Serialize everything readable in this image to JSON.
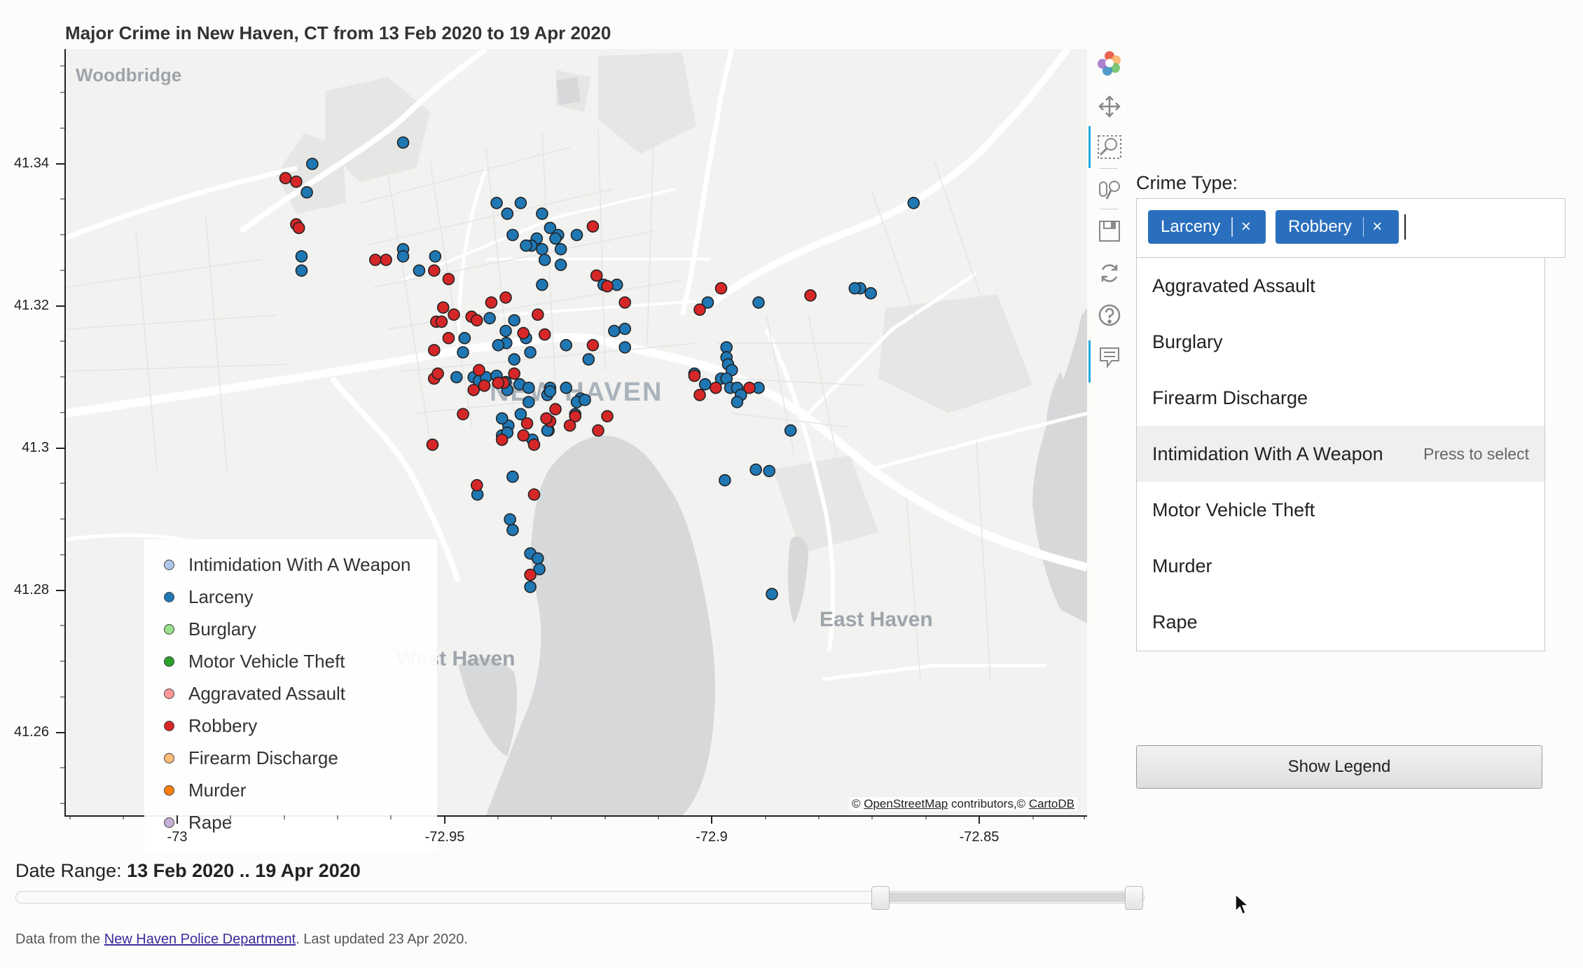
{
  "title": "Major Crime in New Haven, CT from 13 Feb 2020 to 19 Apr 2020",
  "map": {
    "place_labels": [
      "Woodbridge",
      "NEW HAVEN",
      "West Haven",
      "East Haven"
    ],
    "attribution": {
      "prefix": "©",
      "osm_link": "OpenStreetMap",
      "middle": "contributors,©",
      "carto_link": "CartoDB"
    },
    "y_ticks": [
      "41.34",
      "41.32",
      "41.3",
      "41.28",
      "41.26"
    ],
    "x_ticks": [
      "-73",
      "-72.95",
      "-72.9",
      "-72.85"
    ],
    "colors": {
      "larceny": "#1f77b4",
      "robbery": "#d62728",
      "water": "#d4d6d8",
      "land": "#f3f3f1"
    },
    "points": {
      "larceny": [
        [
          -72.958,
          41.343
        ],
        [
          -72.975,
          41.34
        ],
        [
          -72.976,
          41.336
        ],
        [
          -72.977,
          41.327
        ],
        [
          -72.977,
          41.325
        ],
        [
          -72.958,
          41.328
        ],
        [
          -72.958,
          41.327
        ],
        [
          -72.955,
          41.325
        ],
        [
          -72.952,
          41.327
        ],
        [
          -72.9405,
          41.3345
        ],
        [
          -72.936,
          41.3345
        ],
        [
          -72.9385,
          41.333
        ],
        [
          -72.932,
          41.333
        ],
        [
          -72.9305,
          41.331
        ],
        [
          -72.929,
          41.33
        ],
        [
          -72.9255,
          41.33
        ],
        [
          -72.9375,
          41.33
        ],
        [
          -72.933,
          41.3295
        ],
        [
          -72.934,
          41.3285
        ],
        [
          -72.935,
          41.3285
        ],
        [
          -72.932,
          41.328
        ],
        [
          -72.9295,
          41.3295
        ],
        [
          -72.9285,
          41.328
        ],
        [
          -72.9315,
          41.3265
        ],
        [
          -72.9285,
          41.3258
        ],
        [
          -72.932,
          41.323
        ],
        [
          -72.9205,
          41.323
        ],
        [
          -72.918,
          41.323
        ],
        [
          -72.9185,
          41.3165
        ],
        [
          -72.9165,
          41.3168
        ],
        [
          -72.9165,
          41.3142
        ],
        [
          -72.9233,
          41.3125
        ],
        [
          -72.9372,
          41.318
        ],
        [
          -72.9388,
          41.3165
        ],
        [
          -72.9418,
          41.3183
        ],
        [
          -72.935,
          41.3155
        ],
        [
          -72.9387,
          41.3148
        ],
        [
          -72.9402,
          41.3145
        ],
        [
          -72.9372,
          41.3125
        ],
        [
          -72.9342,
          41.3135
        ],
        [
          -72.9275,
          41.3145
        ],
        [
          -72.9465,
          41.3155
        ],
        [
          -72.9468,
          41.3135
        ],
        [
          -72.948,
          41.31
        ],
        [
          -72.9448,
          41.31
        ],
        [
          -72.9438,
          41.3095
        ],
        [
          -72.9425,
          41.31
        ],
        [
          -72.9405,
          41.3102
        ],
        [
          -72.9388,
          41.3093
        ],
        [
          -72.9385,
          41.3082
        ],
        [
          -72.9362,
          41.309
        ],
        [
          -72.9345,
          41.3085
        ],
        [
          -72.9305,
          41.3085
        ],
        [
          -72.931,
          41.3075
        ],
        [
          -72.9305,
          41.308
        ],
        [
          -72.9275,
          41.3085
        ],
        [
          -72.9248,
          41.307
        ],
        [
          -72.9255,
          41.3065
        ],
        [
          -72.924,
          41.3068
        ],
        [
          -72.9258,
          41.3048
        ],
        [
          -72.9345,
          41.3065
        ],
        [
          -72.936,
          41.3048
        ],
        [
          -72.9383,
          41.3032
        ],
        [
          -72.9395,
          41.3042
        ],
        [
          -72.9395,
          41.3018
        ],
        [
          -72.9338,
          41.3012
        ],
        [
          -72.9308,
          41.3025
        ],
        [
          -72.9385,
          41.3022
        ],
        [
          -72.9375,
          41.296
        ],
        [
          -72.9441,
          41.2935
        ],
        [
          -72.938,
          41.29
        ],
        [
          -72.9375,
          41.2885
        ],
        [
          -72.9342,
          41.2852
        ],
        [
          -72.9328,
          41.2845
        ],
        [
          -72.9325,
          41.283
        ],
        [
          -72.9342,
          41.2805
        ],
        [
          -72.901,
          41.3205
        ],
        [
          -72.8975,
          41.3142
        ],
        [
          -72.8975,
          41.3128
        ],
        [
          -72.8972,
          41.3118
        ],
        [
          -72.8965,
          41.311
        ],
        [
          -72.8985,
          41.3098
        ],
        [
          -72.9015,
          41.309
        ],
        [
          -72.9035,
          41.3105
        ],
        [
          -72.8975,
          41.3098
        ],
        [
          -72.8968,
          41.3085
        ],
        [
          -72.8955,
          41.3085
        ],
        [
          -72.8948,
          41.3075
        ],
        [
          -72.8955,
          41.3065
        ],
        [
          -72.8915,
          41.3085
        ],
        [
          -72.8855,
          41.3025
        ],
        [
          -72.892,
          41.297
        ],
        [
          -72.8895,
          41.2968
        ],
        [
          -72.8978,
          41.2955
        ],
        [
          -72.889,
          41.2795
        ],
        [
          -72.8625,
          41.3345
        ],
        [
          -72.8725,
          41.3225
        ],
        [
          -72.8735,
          41.3225
        ],
        [
          -72.8705,
          41.3218
        ],
        [
          -72.8915,
          41.3205
        ],
        [
          -72.931,
          41.3025
        ]
      ],
      "robbery": [
        [
          -72.98,
          41.338
        ],
        [
          -72.978,
          41.3375
        ],
        [
          -72.978,
          41.3315
        ],
        [
          -72.9775,
          41.331
        ],
        [
          -72.9612,
          41.3265
        ],
        [
          -72.9632,
          41.3265
        ],
        [
          -72.9522,
          41.325
        ],
        [
          -72.9495,
          41.3238
        ],
        [
          -72.9505,
          41.3198
        ],
        [
          -72.9518,
          41.3178
        ],
        [
          -72.9452,
          41.3185
        ],
        [
          -72.9442,
          41.318
        ],
        [
          -72.9415,
          41.3205
        ],
        [
          -72.9388,
          41.3212
        ],
        [
          -72.9328,
          41.3188
        ],
        [
          -72.9355,
          41.3162
        ],
        [
          -72.9315,
          41.316
        ],
        [
          -72.9225,
          41.3145
        ],
        [
          -72.9218,
          41.3243
        ],
        [
          -72.9198,
          41.3228
        ],
        [
          -72.9165,
          41.3205
        ],
        [
          -72.9372,
          41.3105
        ],
        [
          -72.9392,
          41.3092
        ],
        [
          -72.9402,
          41.3092
        ],
        [
          -72.9428,
          41.3088
        ],
        [
          -72.9438,
          41.311
        ],
        [
          -72.9448,
          41.3082
        ],
        [
          -72.9522,
          41.3098
        ],
        [
          -72.9515,
          41.3105
        ],
        [
          -72.9468,
          41.3048
        ],
        [
          -72.9348,
          41.3035
        ],
        [
          -72.9305,
          41.3038
        ],
        [
          -72.9258,
          41.3045
        ],
        [
          -72.9335,
          41.3005
        ],
        [
          -72.9442,
          41.2948
        ],
        [
          -72.9395,
          41.3012
        ],
        [
          -72.9335,
          41.2935
        ],
        [
          -72.9342,
          41.2822
        ],
        [
          -72.9295,
          41.3055
        ],
        [
          -72.9198,
          41.3045
        ],
        [
          -72.8985,
          41.3225
        ],
        [
          -72.9025,
          41.3195
        ],
        [
          -72.9035,
          41.3102
        ],
        [
          -72.9025,
          41.3075
        ],
        [
          -72.8995,
          41.3085
        ],
        [
          -72.8932,
          41.3085
        ],
        [
          -72.8818,
          41.3215
        ],
        [
          -72.9225,
          41.3312
        ],
        [
          -72.9485,
          41.3188
        ],
        [
          -72.9508,
          41.3178
        ],
        [
          -72.9495,
          41.3155
        ],
        [
          -72.9522,
          41.3138
        ],
        [
          -72.9355,
          41.3018
        ],
        [
          -72.9215,
          41.3025
        ],
        [
          -72.9525,
          41.3005
        ],
        [
          -72.9312,
          41.3042
        ],
        [
          -72.9268,
          41.3032
        ]
      ]
    }
  },
  "legend": [
    {
      "label": "Intimidation With A Weapon",
      "color": "#aec7e8"
    },
    {
      "label": "Larceny",
      "color": "#1f77b4"
    },
    {
      "label": "Burglary",
      "color": "#98df8a"
    },
    {
      "label": "Motor Vehicle Theft",
      "color": "#2ca02c"
    },
    {
      "label": "Aggravated Assault",
      "color": "#ff9896"
    },
    {
      "label": "Robbery",
      "color": "#d62728"
    },
    {
      "label": "Firearm Discharge",
      "color": "#ffbb78"
    },
    {
      "label": "Murder",
      "color": "#ff7f0e"
    },
    {
      "label": "Rape",
      "color": "#c5b0d5"
    }
  ],
  "toolbar": {
    "tools": [
      "bokeh-logo-icon",
      "pan-icon",
      "box-zoom-icon",
      "wheel-zoom-icon",
      "save-icon",
      "reset-icon",
      "help-icon",
      "hover-icon"
    ]
  },
  "crime_select": {
    "label": "Crime Type:",
    "selected": [
      "Larceny",
      "Robbery"
    ],
    "remove_glyph": "×",
    "options": [
      "Aggravated Assault",
      "Burglary",
      "Firearm Discharge",
      "Intimidation With A Weapon",
      "Motor Vehicle Theft",
      "Murder",
      "Rape"
    ],
    "highlighted_index": 3,
    "hint": "Press to select"
  },
  "legend_button": "Show Legend",
  "date_range": {
    "label": "Date Range: ",
    "value": "13 Feb 2020 .. 19 Apr 2020"
  },
  "footer": {
    "prefix": "Data from the ",
    "link": "New Haven Police Department",
    "suffix": ". Last updated 23 Apr 2020."
  }
}
